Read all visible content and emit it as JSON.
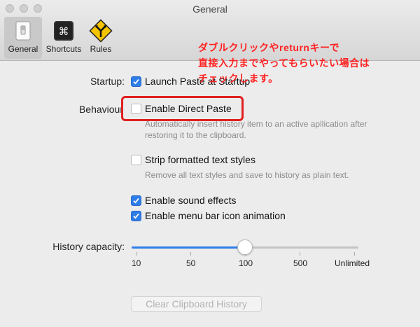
{
  "window": {
    "title": "General"
  },
  "toolbar": {
    "items": [
      {
        "label": "General",
        "icon": "switch-icon"
      },
      {
        "label": "Shortcuts",
        "icon": "command-key-icon"
      },
      {
        "label": "Rules",
        "icon": "fork-road-sign-icon"
      }
    ],
    "active": "General"
  },
  "settings": {
    "startup_label": "Startup:",
    "behaviour_label": "Behaviour",
    "launch_at_login": {
      "label": "Launch Paste at Startup",
      "checked": true
    },
    "direct_paste": {
      "label": "Enable Direct Paste",
      "checked": false,
      "description": "Automatically insert history item to an active apllication after restoring it to the clipboard."
    },
    "strip_styles": {
      "label": "Strip formatted text styles",
      "checked": false,
      "description": "Remove all text styles and save to history as plain text."
    },
    "sound_effects": {
      "label": "Enable sound effects",
      "checked": true
    },
    "menu_bar_animation": {
      "label": "Enable menu bar icon animation",
      "checked": true
    }
  },
  "history": {
    "label": "History capacity:",
    "ticks": [
      "10",
      "50",
      "100",
      "500",
      "Unlimited"
    ],
    "selected": "100",
    "selected_index": 2
  },
  "clear_button": {
    "label": "Clear Clipboard History",
    "enabled": false
  },
  "annotation": {
    "lines": [
      "ダブルクリックやreturnキーで",
      "直接入力までやってもらいたい場合は",
      "チェックします。"
    ],
    "color": "#ff2222"
  },
  "colors": {
    "accent": "#2f7de8",
    "highlight": "#e02020"
  }
}
